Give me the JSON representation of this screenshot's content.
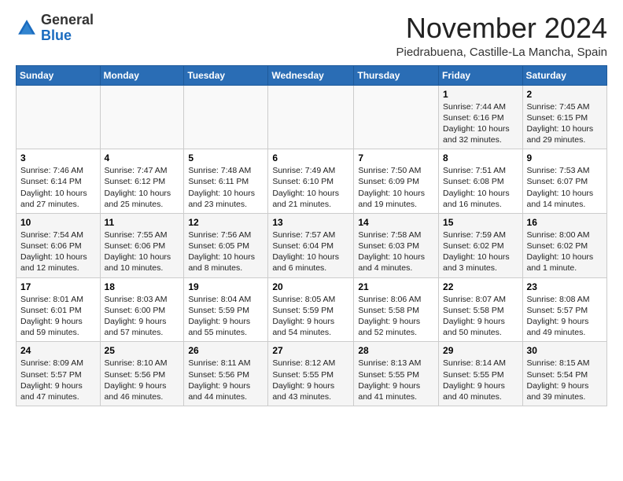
{
  "header": {
    "logo_general": "General",
    "logo_blue": "Blue",
    "month": "November 2024",
    "location": "Piedrabuena, Castille-La Mancha, Spain"
  },
  "weekdays": [
    "Sunday",
    "Monday",
    "Tuesday",
    "Wednesday",
    "Thursday",
    "Friday",
    "Saturday"
  ],
  "weeks": [
    [
      {
        "day": "",
        "info": ""
      },
      {
        "day": "",
        "info": ""
      },
      {
        "day": "",
        "info": ""
      },
      {
        "day": "",
        "info": ""
      },
      {
        "day": "",
        "info": ""
      },
      {
        "day": "1",
        "info": "Sunrise: 7:44 AM\nSunset: 6:16 PM\nDaylight: 10 hours and 32 minutes."
      },
      {
        "day": "2",
        "info": "Sunrise: 7:45 AM\nSunset: 6:15 PM\nDaylight: 10 hours and 29 minutes."
      }
    ],
    [
      {
        "day": "3",
        "info": "Sunrise: 7:46 AM\nSunset: 6:14 PM\nDaylight: 10 hours and 27 minutes."
      },
      {
        "day": "4",
        "info": "Sunrise: 7:47 AM\nSunset: 6:12 PM\nDaylight: 10 hours and 25 minutes."
      },
      {
        "day": "5",
        "info": "Sunrise: 7:48 AM\nSunset: 6:11 PM\nDaylight: 10 hours and 23 minutes."
      },
      {
        "day": "6",
        "info": "Sunrise: 7:49 AM\nSunset: 6:10 PM\nDaylight: 10 hours and 21 minutes."
      },
      {
        "day": "7",
        "info": "Sunrise: 7:50 AM\nSunset: 6:09 PM\nDaylight: 10 hours and 19 minutes."
      },
      {
        "day": "8",
        "info": "Sunrise: 7:51 AM\nSunset: 6:08 PM\nDaylight: 10 hours and 16 minutes."
      },
      {
        "day": "9",
        "info": "Sunrise: 7:53 AM\nSunset: 6:07 PM\nDaylight: 10 hours and 14 minutes."
      }
    ],
    [
      {
        "day": "10",
        "info": "Sunrise: 7:54 AM\nSunset: 6:06 PM\nDaylight: 10 hours and 12 minutes."
      },
      {
        "day": "11",
        "info": "Sunrise: 7:55 AM\nSunset: 6:06 PM\nDaylight: 10 hours and 10 minutes."
      },
      {
        "day": "12",
        "info": "Sunrise: 7:56 AM\nSunset: 6:05 PM\nDaylight: 10 hours and 8 minutes."
      },
      {
        "day": "13",
        "info": "Sunrise: 7:57 AM\nSunset: 6:04 PM\nDaylight: 10 hours and 6 minutes."
      },
      {
        "day": "14",
        "info": "Sunrise: 7:58 AM\nSunset: 6:03 PM\nDaylight: 10 hours and 4 minutes."
      },
      {
        "day": "15",
        "info": "Sunrise: 7:59 AM\nSunset: 6:02 PM\nDaylight: 10 hours and 3 minutes."
      },
      {
        "day": "16",
        "info": "Sunrise: 8:00 AM\nSunset: 6:02 PM\nDaylight: 10 hours and 1 minute."
      }
    ],
    [
      {
        "day": "17",
        "info": "Sunrise: 8:01 AM\nSunset: 6:01 PM\nDaylight: 9 hours and 59 minutes."
      },
      {
        "day": "18",
        "info": "Sunrise: 8:03 AM\nSunset: 6:00 PM\nDaylight: 9 hours and 57 minutes."
      },
      {
        "day": "19",
        "info": "Sunrise: 8:04 AM\nSunset: 5:59 PM\nDaylight: 9 hours and 55 minutes."
      },
      {
        "day": "20",
        "info": "Sunrise: 8:05 AM\nSunset: 5:59 PM\nDaylight: 9 hours and 54 minutes."
      },
      {
        "day": "21",
        "info": "Sunrise: 8:06 AM\nSunset: 5:58 PM\nDaylight: 9 hours and 52 minutes."
      },
      {
        "day": "22",
        "info": "Sunrise: 8:07 AM\nSunset: 5:58 PM\nDaylight: 9 hours and 50 minutes."
      },
      {
        "day": "23",
        "info": "Sunrise: 8:08 AM\nSunset: 5:57 PM\nDaylight: 9 hours and 49 minutes."
      }
    ],
    [
      {
        "day": "24",
        "info": "Sunrise: 8:09 AM\nSunset: 5:57 PM\nDaylight: 9 hours and 47 minutes."
      },
      {
        "day": "25",
        "info": "Sunrise: 8:10 AM\nSunset: 5:56 PM\nDaylight: 9 hours and 46 minutes."
      },
      {
        "day": "26",
        "info": "Sunrise: 8:11 AM\nSunset: 5:56 PM\nDaylight: 9 hours and 44 minutes."
      },
      {
        "day": "27",
        "info": "Sunrise: 8:12 AM\nSunset: 5:55 PM\nDaylight: 9 hours and 43 minutes."
      },
      {
        "day": "28",
        "info": "Sunrise: 8:13 AM\nSunset: 5:55 PM\nDaylight: 9 hours and 41 minutes."
      },
      {
        "day": "29",
        "info": "Sunrise: 8:14 AM\nSunset: 5:55 PM\nDaylight: 9 hours and 40 minutes."
      },
      {
        "day": "30",
        "info": "Sunrise: 8:15 AM\nSunset: 5:54 PM\nDaylight: 9 hours and 39 minutes."
      }
    ]
  ]
}
